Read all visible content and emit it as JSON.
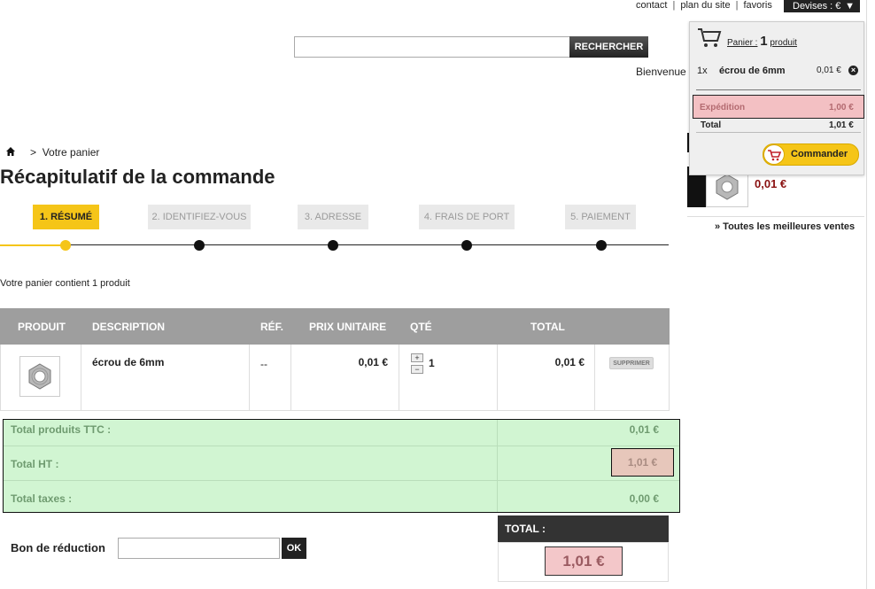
{
  "header": {
    "links": [
      "contact",
      "plan du site",
      "favoris"
    ],
    "currency_label": "Devises : €",
    "search_placeholder": "",
    "search_button": "RECHERCHER",
    "welcome": "Bienvenue"
  },
  "breadcrumb": {
    "current": "Votre panier",
    "separator": ">"
  },
  "page_title": "Récapitulatif de la commande",
  "steps": [
    {
      "label": "1. RÉSUMÉ",
      "active": true
    },
    {
      "label": "2. IDENTIFIEZ-VOUS",
      "active": false
    },
    {
      "label": "3. ADRESSE",
      "active": false
    },
    {
      "label": "4. FRAIS DE PORT",
      "active": false
    },
    {
      "label": "5. PAIEMENT",
      "active": false
    }
  ],
  "cart_summary_text": "Votre panier contient 1 produit",
  "table": {
    "headers": [
      "PRODUIT",
      "DESCRIPTION",
      "RÉF.",
      "PRIX UNITAIRE",
      "QTÉ",
      "TOTAL"
    ],
    "rows": [
      {
        "description": "écrou de 6mm",
        "ref": "--",
        "unit_price": "0,01 €",
        "qty": "1",
        "total": "0,01 €",
        "remove_label": "SUPPRIMER"
      }
    ]
  },
  "totals": {
    "products_ttc_label": "Total produits TTC :",
    "products_ttc_value": "0,01 €",
    "ht_label": "Total HT :",
    "ht_value": "1,01 €",
    "taxes_label": "Total taxes :",
    "taxes_value": "0,00 €"
  },
  "grand_total": {
    "label": "TOTAL :",
    "value": "1,01 €"
  },
  "voucher": {
    "label": "Bon de réduction",
    "button": "OK",
    "value": ""
  },
  "mini_cart": {
    "title_prefix": "Panier :",
    "count": "1",
    "title_suffix": "produit",
    "item_qty": "1x",
    "item_name": "écrou de 6mm",
    "item_price": "0,01 €",
    "shipping_label": "Expédition",
    "shipping_value": "1,00 €",
    "total_label": "Total",
    "total_value": "1,01 €",
    "order_button": "Commander"
  },
  "sidebar": {
    "best_seller_price": "0,01 €",
    "best_sellers_link": "» Toutes les meilleures ventes"
  }
}
